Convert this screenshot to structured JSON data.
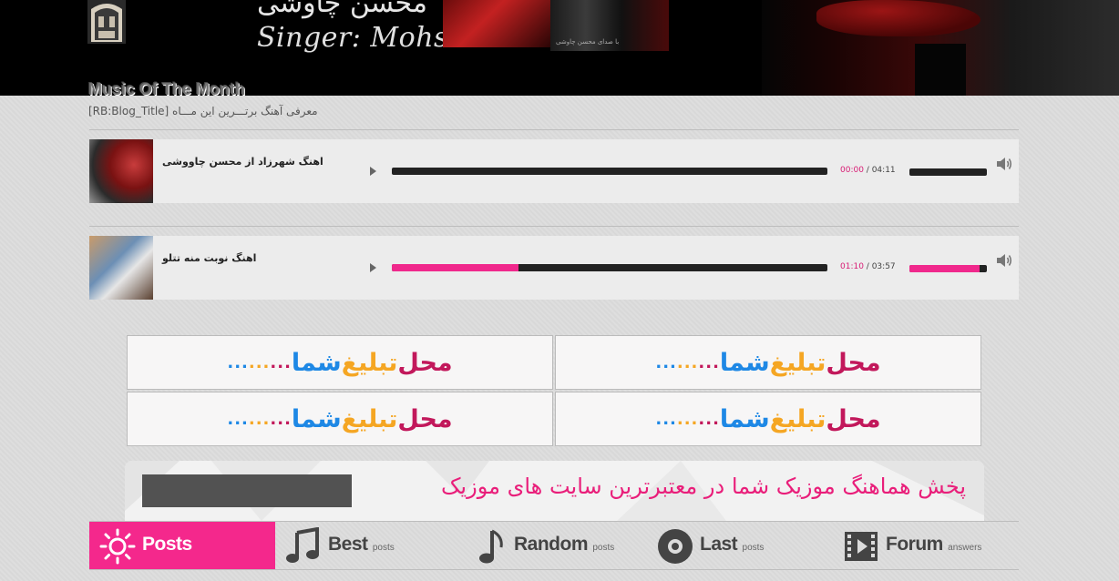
{
  "header": {
    "farsi_title": "محسن چاوشی",
    "singer_line": "Singer: Mohsen Chavoshi",
    "thumb_caption": "با صدای محسن چاوشی"
  },
  "block": {
    "title": "Music Of The Month",
    "subtitle": "[RB:Blog_Title] معرفی آهنگ برتـــرین این مـــاه"
  },
  "players": [
    {
      "title": "اهنگ شهرزاد از محسن چاووشی",
      "current": "00:00",
      "separator": " / ",
      "duration": "04:11",
      "progress": 0,
      "volume": 0
    },
    {
      "title": "اهنگ نوبت منه تتلو",
      "current": "01:10",
      "separator": " / ",
      "duration": "03:57",
      "progress": 0.29,
      "volume": 0.9
    }
  ],
  "ads": {
    "word1": "محل",
    "word2": "تبلیغ",
    "word3": "شما",
    "dots1": "...",
    "dots2": "...",
    "dots3": "..."
  },
  "promo": {
    "text": "پخش هماهنگ موزیک شما در معتبرترین سایت های موزیک"
  },
  "nav": {
    "items": [
      {
        "label": "Posts",
        "small": "",
        "icon": "sun-icon"
      },
      {
        "label": "Best",
        "small": "posts",
        "icon": "music-note-double-icon"
      },
      {
        "label": "Random",
        "small": "posts",
        "icon": "music-note-icon"
      },
      {
        "label": "Last",
        "small": "posts",
        "icon": "disc-icon"
      },
      {
        "label": "Forum",
        "small": "answers",
        "icon": "film-icon"
      }
    ]
  },
  "colors": {
    "accent": "#f4288c",
    "ad_red": "#c2185b",
    "ad_orange": "#f5a623",
    "ad_blue": "#1e88e5"
  }
}
